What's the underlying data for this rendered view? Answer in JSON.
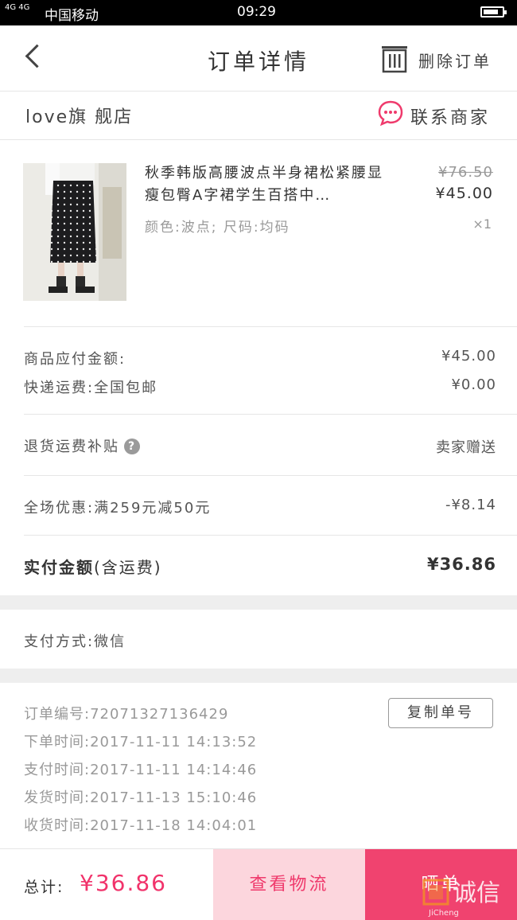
{
  "status_bar": {
    "signal": "4G 4G",
    "carrier": "中国移动",
    "time": "09:29"
  },
  "nav": {
    "title": "订单详情",
    "delete_label": "删除订单"
  },
  "shop": {
    "name": "love旗 舰店",
    "contact_label": "联系商家"
  },
  "product": {
    "title": "秋季韩版高腰波点半身裙松紧腰显瘦包臀A字裙学生百搭中…",
    "sku": "颜色:波点; 尺码:均码",
    "original_price": "¥76.50",
    "price": "¥45.00",
    "quantity": "×1"
  },
  "summary": {
    "goods_amount_label": "商品应付金额:",
    "goods_amount": "¥45.00",
    "shipping_label": "快递运费:全国包邮",
    "shipping": "¥0.00",
    "return_subsidy_label": "退货运费补贴",
    "return_subsidy_value": "卖家赠送",
    "discount_label": "全场优惠:满259元减50元",
    "discount_value": "-¥8.14",
    "paid_label_bold": "实付金额",
    "paid_label_suffix": "(含运费)",
    "paid_value": "¥36.86"
  },
  "payment": {
    "method": "支付方式:微信"
  },
  "order_info": {
    "order_no": "订单编号:720713271364​29",
    "copy_label": "复制单号",
    "placed": "下单时间:2017-11-11 14:13:52",
    "paid": "支付时间:2017-11-11 14:14:46",
    "shipped": "发货时间:2017-11-13 15:10:46",
    "received": "收货时间:2017-11-18 14:04:01"
  },
  "bottom": {
    "total_label": "总计:",
    "total_value": "¥36.86",
    "logistics_label": "查看物流",
    "confirm_label": "晒单"
  },
  "watermark": {
    "text": "诚信",
    "sub": "JiCheng"
  },
  "colors": {
    "accent": "#f0436f",
    "accent_light": "#fcd6dd",
    "price_red": "#f1336b",
    "chat_icon": "#ef3a6c"
  }
}
